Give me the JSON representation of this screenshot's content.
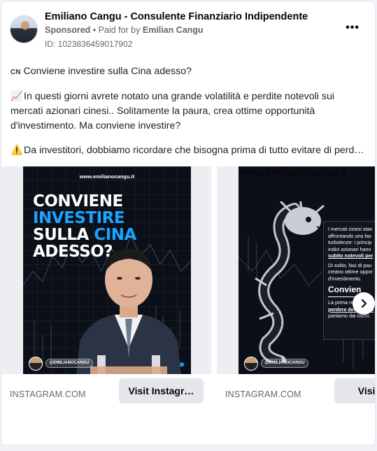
{
  "post": {
    "page_name": "Emiliano Cangu - Consulente Finanziario Indipendente",
    "sponsored": "Sponsored",
    "paid_for_prefix": "• Paid for by",
    "paid_for_name": "Emilian Cangu",
    "ad_id": "ID: 1023836459017902",
    "more_label": "•••"
  },
  "body": {
    "flag": "CN",
    "line1": "Conviene investire sulla Cina adesso?",
    "chart_emoji": "📈",
    "para2": "In questi giorni avrete notato una grande volatilità e perdite notevoli sui mercati azionari cinesi.. Solitamente la paura, crea ottime opportunità d'investimento. Ma conviene investire?",
    "warn_emoji": "⚠️",
    "para3": "Da investitori, dobbiamo ricordare che bisogna prima di tutto evitare di perder…"
  },
  "carousel": {
    "slides": [
      {
        "poster_url": "www.emilianocangu.it",
        "headline_1": "CONVIENE",
        "headline_2": "INVESTIRE",
        "headline_3a": "SULLA",
        "headline_3b": "CINA",
        "headline_4": "ADESSO?",
        "brand_handle": "@EMILIANOCANGU",
        "domain": "INSTAGRAM.COM",
        "cta": "Visit Instagr…"
      },
      {
        "poster_url": "www.emilianocangu.it",
        "text_1": "I mercati cinesi stan",
        "text_2": "affrontando una fas",
        "text_3": "turbolenze: i princip",
        "text_4": "indici azionari hann",
        "text_5": "subito notevoli per",
        "text_6": "Di solito, fasi di pau",
        "text_7": "creano ottime oppor",
        "text_8": "d'investimento.",
        "big_text": "Convien",
        "text_9": "La prima regola è r",
        "text_10": "perdere denaro, qu",
        "text_11": "partiamo dai rischi.",
        "brand_handle": "@EMILIANOCANGU",
        "domain": "INSTAGRAM.COM",
        "cta": "Visit Ins"
      }
    ]
  },
  "colors": {
    "accent_blue": "#1aa3ff",
    "secondary_text": "#65676b",
    "button_bg": "#e4e6eb"
  },
  "icons": {
    "more": "more-horizontal-icon",
    "next": "chevron-right-icon"
  }
}
